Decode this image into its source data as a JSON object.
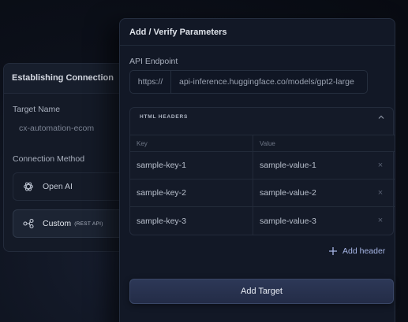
{
  "establishing": {
    "title": "Establishing Connection",
    "target_name_label": "Target Name",
    "target_name_value": "cx-automation-ecom",
    "connection_method_label": "Connection Method",
    "methods": [
      {
        "label": "Open AI",
        "icon": "openai-icon"
      },
      {
        "label": "Custom",
        "sub": "(REST API)",
        "icon": "webhook-icon"
      }
    ]
  },
  "verify": {
    "title": "Add / Verify Parameters",
    "api_endpoint_label": "API Endpoint",
    "protocol": "https://",
    "url": "api-inference.huggingface.co/models/gpt2-large",
    "headers_section_title": "HTML HEADERS",
    "columns": [
      "Key",
      "Value"
    ],
    "rows": [
      {
        "key": "sample-key-1",
        "value": "sample-value-1"
      },
      {
        "key": "sample-key-2",
        "value": "sample-value-2"
      },
      {
        "key": "sample-key-3",
        "value": "sample-value-3"
      }
    ],
    "add_header_label": "Add header",
    "add_target_label": "Add Target"
  }
}
